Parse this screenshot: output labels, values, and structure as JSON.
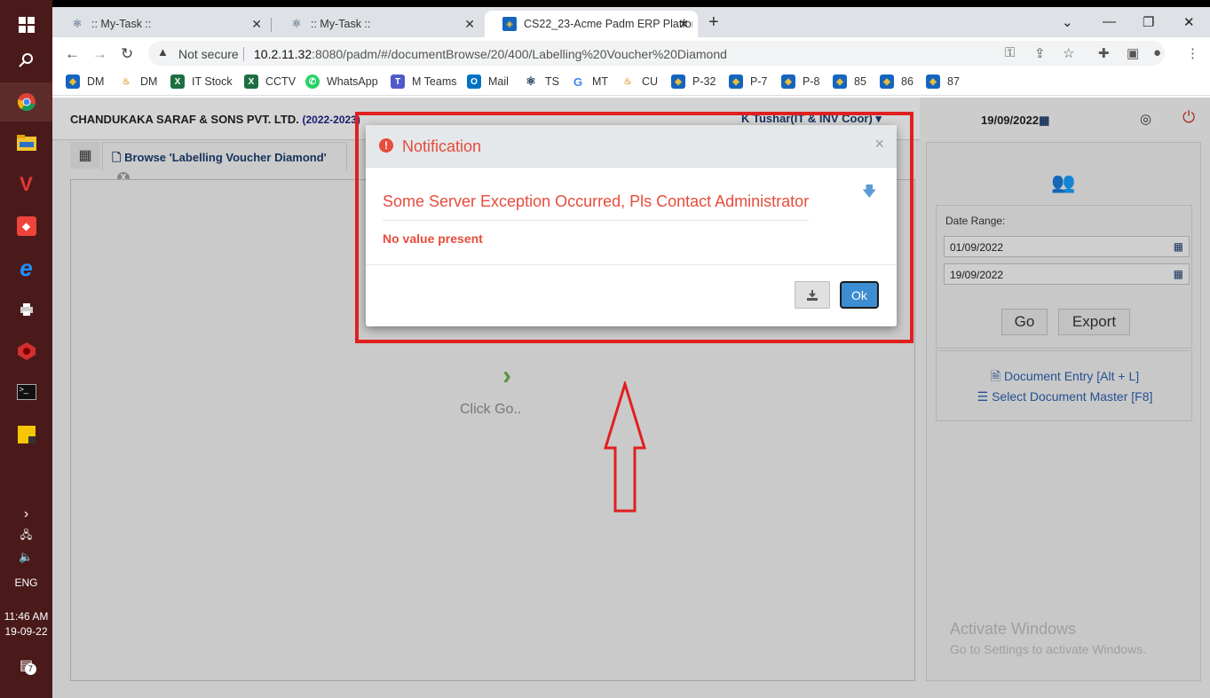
{
  "taskbar": {
    "icons": [
      "windows-icon",
      "search-icon",
      "chrome-icon",
      "file-explorer-icon",
      "app-v-icon",
      "app-anydesk-icon",
      "internet-explorer-icon",
      "printer-icon",
      "app-red-icon",
      "terminal-icon",
      "sticky-notes-icon"
    ],
    "lang": "ENG",
    "time": "11:46 AM",
    "date": "19-09-22",
    "notifications": "7"
  },
  "browser": {
    "tabs": [
      {
        "title": ":: My-Task ::"
      },
      {
        "title": ":: My-Task ::"
      },
      {
        "title": "CS22_23-Acme Padm ERP Platfor"
      }
    ],
    "not_secure": "Not secure",
    "url_host": "10.2.11.32",
    "url_rest": ":8080/padm/#/documentBrowse/20/400/Labelling%20Voucher%20Diamond",
    "bookmarks": [
      "DM",
      "DM",
      "IT Stock",
      "CCTV",
      "WhatsApp",
      "M Teams",
      "Mail",
      "TS",
      "MT",
      "CU",
      "P-32",
      "P-7",
      "P-8",
      "85",
      "86",
      "87"
    ]
  },
  "app": {
    "company": "CHANDUKAKA SARAF & SONS PVT. LTD.",
    "year": "(2022-2023)",
    "user": "K Tushar(IT & INV Coor)",
    "tab_label": "Browse 'Labelling Voucher Diamond'",
    "tab_close": "X",
    "click_go": "Click Go..",
    "date_top": "19/09/2022",
    "date_range_label": "Date Range:",
    "date_from": "01/09/2022",
    "date_to": "19/09/2022",
    "go": "Go",
    "export": "Export",
    "doc_entry": "Document Entry [Alt + L]",
    "select_master": "Select Document Master [F8]",
    "activate_title": "Activate Windows",
    "activate_sub": "Go to Settings to activate Windows."
  },
  "modal": {
    "title": "Notification",
    "message": "Some Server Exception Occurred, Pls Contact Administrator",
    "detail": "No value present",
    "ok": "Ok",
    "close": "×"
  },
  "colors": {
    "error": "#e74c3c",
    "annotation": "#e02020",
    "primary_button": "#3c8dd2"
  }
}
